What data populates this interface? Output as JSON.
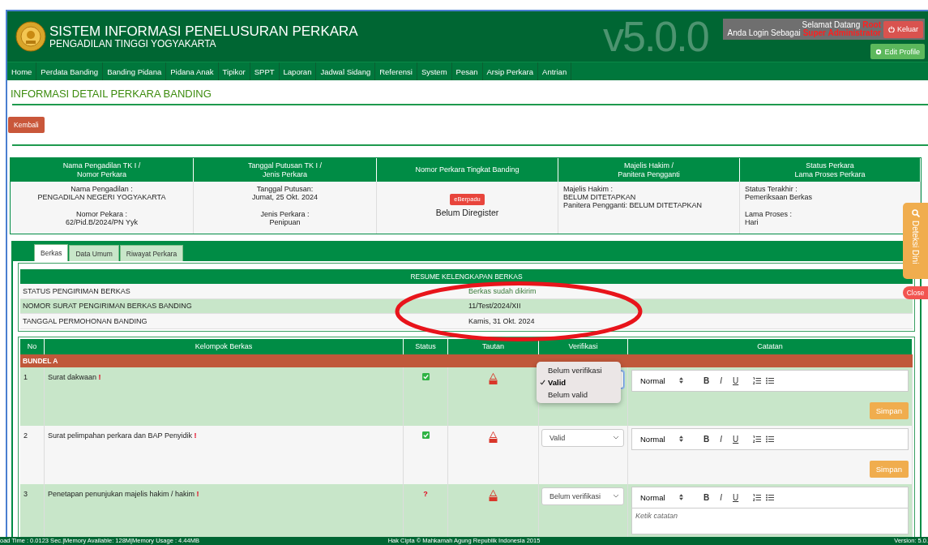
{
  "header": {
    "title": "SISTEM INFORMASI PENELUSURAN PERKARA",
    "subtitle": "PENGADILAN TINGGI YOGYAKARTA",
    "version_mark": "v5.0.0",
    "greeting": "Selamat Datang",
    "user": "Root",
    "role_label": "Anda Login Sebagai",
    "role": "Super Administrator",
    "logout_button": "Keluar",
    "edit_profile_button": "Edit Profile"
  },
  "nav": [
    "Home",
    "Perdata Banding",
    "Banding Pidana",
    "Pidana Anak",
    "Tipikor",
    "SPPT",
    "Laporan",
    "Jadwal Sidang",
    "Referensi",
    "System",
    "Pesan",
    "Arsip Perkara",
    "Antrian"
  ],
  "page_title": "INFORMASI DETAIL PERKARA BANDING",
  "back_button": "Kembali",
  "info_table": {
    "headers": [
      [
        "Nama Pengadilan TK I /",
        "Nomor Perkara"
      ],
      [
        "Tanggal Putusan TK I /",
        "Jenis Perkara"
      ],
      [
        "Nomor Perkara Tingkat Banding"
      ],
      [
        "Majelis Hakim /",
        "Panitera Pengganti"
      ],
      [
        "Status Perkara",
        "Lama Proses Perkara"
      ]
    ],
    "cells": [
      {
        "kind": "centered",
        "groups": [
          [
            "Nama Pengadilan :",
            "PENGADILAN NEGERI YOGYAKARTA"
          ],
          [
            "Nomor Pekara :",
            "62/Pid.B/2024/PN Yyk"
          ]
        ]
      },
      {
        "kind": "centered",
        "groups": [
          [
            "Tanggal Putusan:",
            "Jumat, 25 Okt. 2024"
          ],
          [
            "Jenis Perkara :",
            "Penipuan"
          ]
        ]
      },
      {
        "kind": "centered",
        "badge": "eBerpadu",
        "groups": [
          [
            "Belum Diregister"
          ]
        ]
      },
      {
        "kind": "plain",
        "groups": [
          [
            "Majelis Hakim :",
            "BELUM DITETAPKAN",
            "Panitera Pengganti: BELUM DITETAPKAN"
          ]
        ]
      },
      {
        "kind": "plain",
        "groups": [
          [
            "Status Terakhir :",
            "Pemeriksaan Berkas"
          ],
          [
            "Lama Proses :",
            "Hari"
          ]
        ]
      }
    ]
  },
  "tabs": [
    {
      "label": "Berkas",
      "selected": true
    },
    {
      "label": "Data Umum",
      "selected": false
    },
    {
      "label": "Riwayat Perkara",
      "selected": false
    }
  ],
  "resume": {
    "title": "RESUME KELENGKAPAN BERKAS",
    "rows": [
      {
        "label": "STATUS PENGIRIMAN BERKAS",
        "value": "Berkas sudah dikirim"
      },
      {
        "label": "NOMOR SURAT PENGIRIMAN BERKAS BANDING",
        "value": "11/Test/2024/XII"
      },
      {
        "label": "TANGGAL PERMOHONAN BANDING",
        "value": "Kamis, 31 Okt. 2024"
      }
    ]
  },
  "berkas": {
    "columns": [
      "No",
      "Kelompok Berkas",
      "Status",
      "Tautan",
      "Verifikasi",
      "Catatan"
    ],
    "group": "BUNDEL A",
    "rows": [
      {
        "no": "1",
        "name": "Surat dakwaan **!**",
        "status": {
          "kind": "check"
        },
        "verification": {
          "open": true,
          "options": [
            {
              "label": "Belum verifikasi",
              "selected": false
            },
            {
              "label": "Valid",
              "selected": true
            },
            {
              "label": "Belum valid",
              "selected": false
            }
          ]
        },
        "editor": {
          "format": "Normal",
          "buttons": [
            "B",
            "I",
            "U"
          ]
        },
        "save_button": "Simpan"
      },
      {
        "no": "2",
        "name": "Surat pelimpahan perkara dan BAP Penyidik **!**",
        "status": {
          "kind": "check"
        },
        "verification": {
          "open": false,
          "value": "Valid"
        },
        "editor": {
          "format": "Normal",
          "buttons": [
            "B",
            "I",
            "U"
          ]
        },
        "save_button": "Simpan"
      },
      {
        "no": "3",
        "name": "Penetapan penunjukan majelis hakim / hakim **!**",
        "status": {
          "kind": "text",
          "text": "?"
        },
        "verification": {
          "open": false,
          "value": "Belum verifikasi"
        },
        "editor": {
          "format": "Normal",
          "buttons": [
            "B",
            "I",
            "U"
          ],
          "placeholder": "Ketik catatan"
        }
      }
    ]
  },
  "side_widget": {
    "label": "Deteksi Dini",
    "close_button": "Close"
  },
  "footer": {
    "left": "oad Time : 0.0123 Sec.|Memory Available: 128M|Memory Usage : 4.44MB",
    "center": "Hak Cipta © Mahkamah Agung Republik Indonesia 2015",
    "right": "Version: 5.0."
  }
}
